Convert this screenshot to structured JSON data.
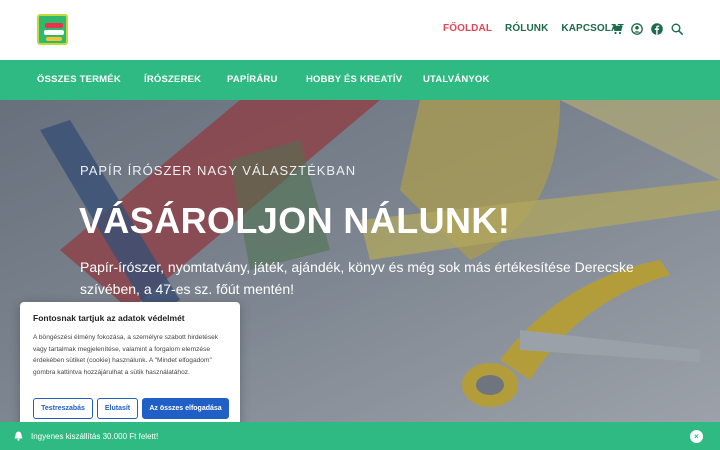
{
  "header": {
    "nav": [
      {
        "label": "FŐOLDAL",
        "active": true
      },
      {
        "label": "RÓLUNK",
        "active": false
      },
      {
        "label": "KAPCSOLAT",
        "active": false
      }
    ],
    "icons": [
      "cart-icon",
      "user-icon",
      "facebook-icon",
      "search-icon"
    ]
  },
  "menu": {
    "items": [
      "ÖSSZES TERMÉK",
      "ÍRÓSZEREK",
      "PAPÍRÁRU",
      "HOBBY ÉS KREATÍV",
      "UTALVÁNYOK"
    ]
  },
  "hero": {
    "subtitle": "PAPÍR ÍRÓSZER NAGY VÁLASZTÉKBAN",
    "title": "VÁSÁROLJON NÁLUNK!",
    "description": "Papír-írószer, nyomtatvány, játék, ajándék, könyv és még sok más értékesítése Derecske szívében, a 47-es sz. főút mentén!"
  },
  "cookie": {
    "title": "Fontosnak tartjuk az adatok védelmét",
    "text": "A böngészési élmény fokozása, a személyre szabott hirdetések vagy tartalmak megjelenítése, valamint a forgalom elemzése érdekében sütiket (cookie) használunk. A \"Mindet elfogadom\" gombra kattintva hozzájárulhat a sütik használatához.",
    "customize_label": "Testreszabás",
    "reject_label": "Elutasít",
    "accept_all_label": "Az összes elfogadása"
  },
  "notice": {
    "text": "Ingyenes kiszállítás 30.000 Ft felett!",
    "close_label": "×"
  },
  "colors": {
    "brand_green": "#2fba83",
    "nav_green": "#1d6b4a",
    "nav_active": "#e04858",
    "button_blue": "#1f5fc6"
  }
}
